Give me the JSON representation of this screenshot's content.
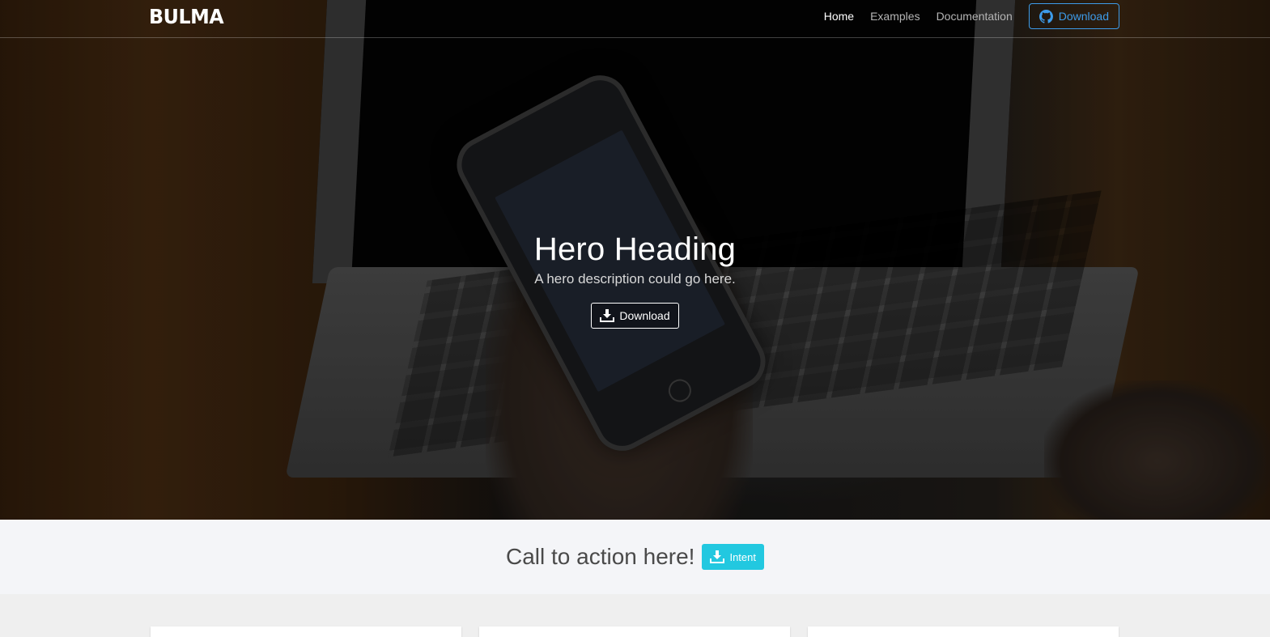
{
  "navbar": {
    "brand": "BULMA",
    "links": [
      {
        "label": "Home",
        "active": true
      },
      {
        "label": "Examples",
        "active": false
      },
      {
        "label": "Documentation",
        "active": false
      }
    ],
    "download_button": {
      "label": "Download",
      "icon": "github-icon"
    }
  },
  "hero": {
    "title": "Hero Heading",
    "subtitle": "A hero description could go here.",
    "button": {
      "label": "Download",
      "icon": "download-icon"
    }
  },
  "cta": {
    "text": "Call to action here!",
    "button": {
      "label": "Intent",
      "icon": "download-icon"
    }
  },
  "colors": {
    "accent_blue": "#3d9be9",
    "cta_button": "#22c8e0",
    "cta_background": "#f4f5f8"
  }
}
